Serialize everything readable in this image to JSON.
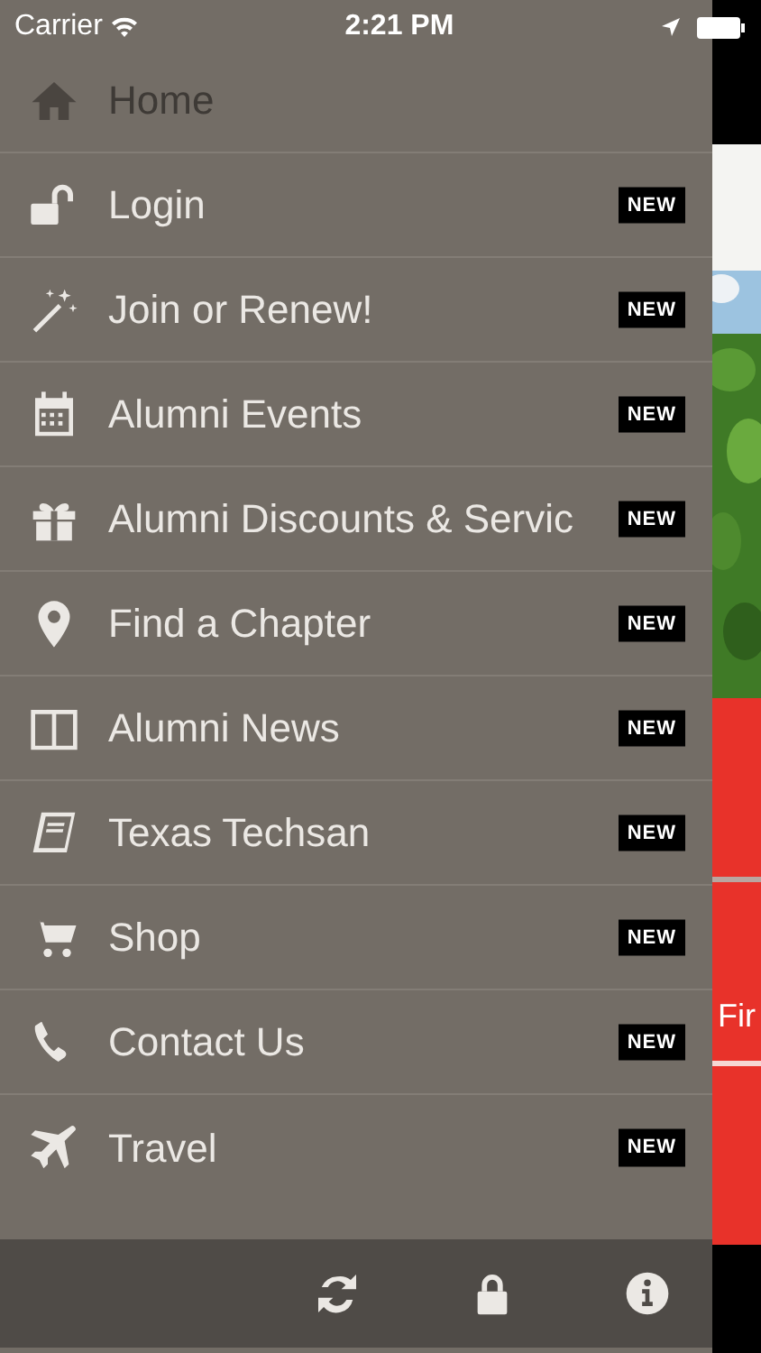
{
  "status_bar": {
    "carrier": "Carrier",
    "time": "2:21 PM"
  },
  "menu": [
    {
      "label": "Home",
      "selected": true
    },
    {
      "label": "Login",
      "selected": false,
      "badge": "NEW"
    },
    {
      "label": "Join or Renew!",
      "selected": false,
      "badge": "NEW"
    },
    {
      "label": "Alumni Events",
      "selected": false,
      "badge": "NEW"
    },
    {
      "label": "Alumni Discounts & Servic",
      "selected": false,
      "badge": "NEW"
    },
    {
      "label": "Find a Chapter",
      "selected": false,
      "badge": "NEW"
    },
    {
      "label": "Alumni News",
      "selected": false,
      "badge": "NEW"
    },
    {
      "label": "Texas Techsan",
      "selected": false,
      "badge": "NEW"
    },
    {
      "label": "Shop",
      "selected": false,
      "badge": "NEW"
    },
    {
      "label": "Contact Us",
      "selected": false,
      "badge": "NEW"
    },
    {
      "label": "Travel",
      "selected": false,
      "badge": "NEW"
    }
  ],
  "behind_content": {
    "label": "Fir"
  }
}
